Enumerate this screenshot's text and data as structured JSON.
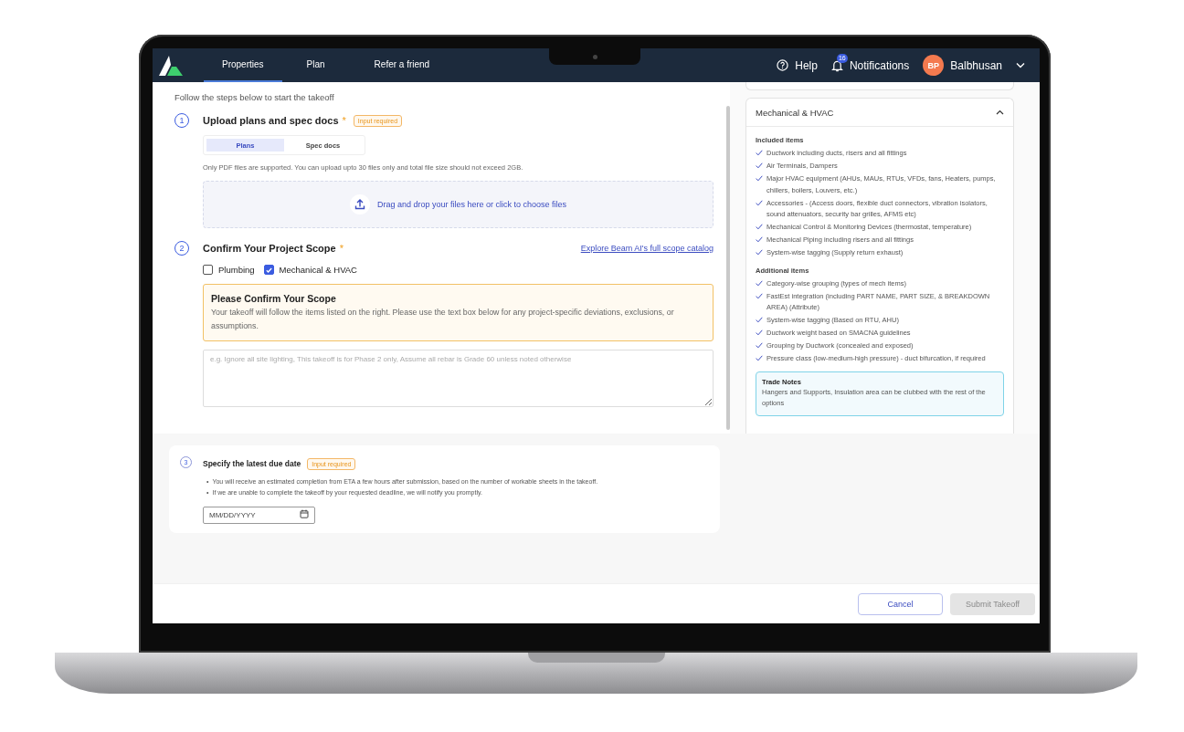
{
  "nav": {
    "items": [
      {
        "label": "Properties",
        "selected": true
      },
      {
        "label": "Plan",
        "selected": false
      },
      {
        "label": "Refer a friend",
        "selected": false
      }
    ],
    "help": "Help",
    "notifications": {
      "label": "Notifications",
      "count": "16"
    },
    "user": {
      "initials": "BP",
      "name": "Balbhusan"
    }
  },
  "intro": "Follow the steps below to start the takeoff",
  "upload": {
    "number": "1",
    "title": "Upload plans and spec docs",
    "required_mark": "*",
    "badge": "Input required",
    "tabs": [
      {
        "label": "Plans",
        "selected": true
      },
      {
        "label": "Spec docs",
        "selected": false
      }
    ],
    "note": "Only PDF files are supported. You can upload upto 30 files only and total file size should not exceed 2GB.",
    "dropzone": "Drag and drop your files here or click to choose files"
  },
  "scope": {
    "number": "2",
    "title": "Confirm Your Project Scope",
    "required_mark": "*",
    "link": "Explore Beam AI's full scope catalog",
    "trades": [
      {
        "label": "Plumbing",
        "checked": false
      },
      {
        "label": "Mechanical & HVAC",
        "checked": true
      }
    ],
    "notice": {
      "title": "Please Confirm Your Scope",
      "text": "Your takeoff will follow the items listed on the right. Please use the text box below for any project-specific deviations, exclusions, or assumptions."
    },
    "notes_placeholder": "e.g. Ignore all site lighting, This takeoff is for Phase 2 only, Assume all rebar is Grade 60 unless noted otherwise"
  },
  "scope_panel": {
    "title": "Mechanical & HVAC",
    "expanded": true,
    "sections": [
      {
        "heading": "Included items",
        "items": [
          "Ductwork including ducts, risers and all fittings",
          "Air Terminals, Dampers",
          "Major HVAC equipment (AHUs, MAUs, RTUs, VFDs, fans, Heaters, pumps, chillers, boilers, Louvers, etc.)",
          "Accessories - (Access doors, flexible duct connectors, vibration isolators, sound attenuators, security bar grilles, AFMS etc)",
          "Mechanical Control & Monitoring Devices (thermostat, temperature)",
          "Mechanical Piping including risers and all fittings",
          "System-wise tagging (Supply return exhaust)"
        ]
      },
      {
        "heading": "Additional items",
        "items": [
          "Category-wise grouping (types of mech items)",
          "FastEst integration (including PART NAME, PART SIZE, & BREAKDOWN AREA) (Attribute)",
          "System-wise tagging (Based on RTU, AHU)",
          "Ductwork weight based on SMACNA guidelines",
          "Grouping by Ductwork (concealed and exposed)",
          "Pressure class (low-medium-high pressure) - duct bifurcation, if required"
        ]
      }
    ],
    "trade_notes": {
      "title": "Trade Notes",
      "text": "Hangers and Supports, Insulation area can be clubbed with the rest of the options"
    }
  },
  "due_date": {
    "number": "3",
    "title": "Specify the latest due date",
    "badge": "Input required",
    "bullet_marker": "•",
    "bullets": [
      "You will receive an estimated completion from ETA a few hours after submission, based on the number of workable sheets in the takeoff.",
      "If we are unable to complete the takeoff by your requested deadline, we will notify you promptly."
    ],
    "date_placeholder": "MM/DD/YYYY"
  },
  "footer": {
    "cancel": "Cancel",
    "submit": {
      "label": "Submit Takeoff",
      "disabled": true
    }
  }
}
